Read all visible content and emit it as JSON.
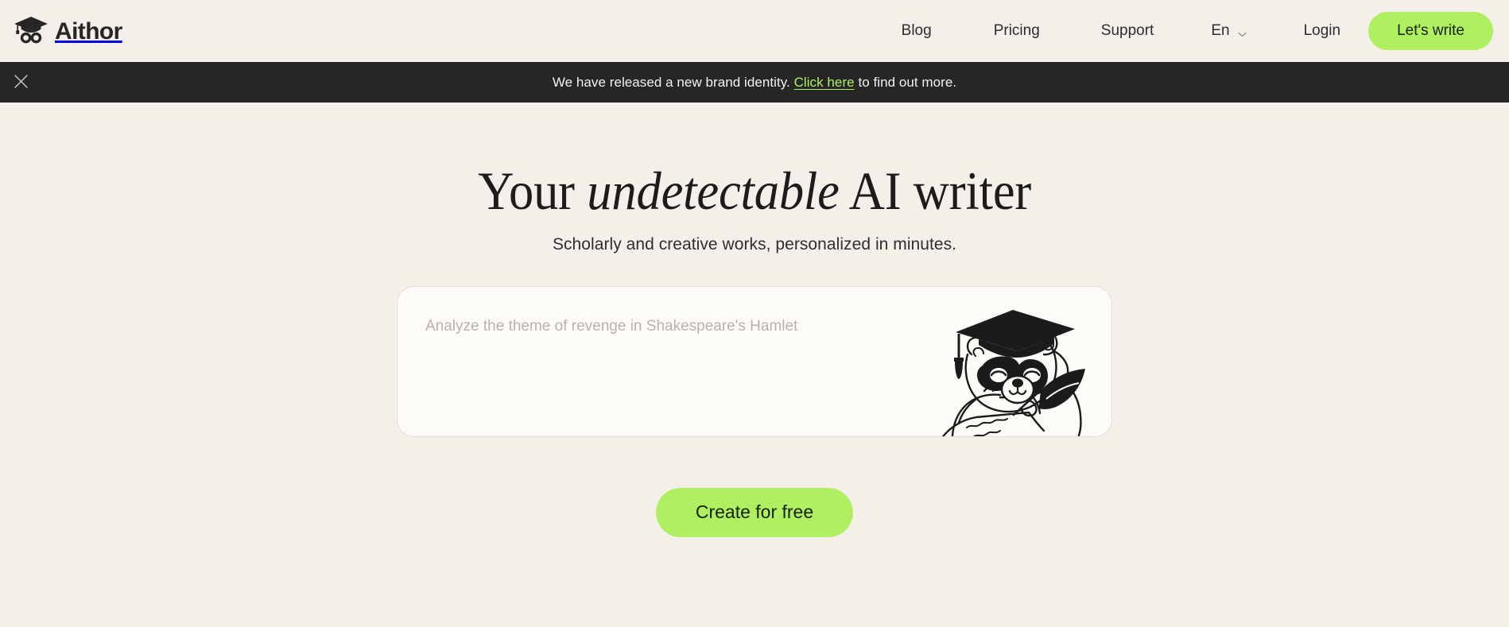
{
  "brand": {
    "name": "Aithor",
    "logo_icon": "graduation-cap-infinity-icon"
  },
  "nav": {
    "items": [
      {
        "label": "Blog",
        "name": "blog"
      },
      {
        "label": "Pricing",
        "name": "pricing"
      },
      {
        "label": "Support",
        "name": "support"
      }
    ],
    "language": {
      "label": "En",
      "caret_icon": "chevron-down-icon"
    },
    "login_label": "Login",
    "cta_label": "Let's write"
  },
  "banner": {
    "close_icon": "close-icon",
    "text_before": "We have released a new brand identity. ",
    "link_label": "Click here",
    "text_after": " to find out more."
  },
  "hero": {
    "title_part1": "Your ",
    "title_emphasis": "undetectable",
    "title_part2": " AI writer",
    "subtitle": "Scholarly and creative works, personalized in minutes."
  },
  "prompt": {
    "value": "",
    "placeholder": "Analyze the theme of revenge in Shakespeare's Hamlet",
    "mascot_icon": "raccoon-graduate-writing-icon"
  },
  "primary_cta": {
    "label": "Create for free"
  },
  "colors": {
    "page_background": "#f4efe9",
    "banner_background": "#262626",
    "accent_green": "#aef05f",
    "card_background": "#fdfbf8",
    "card_border": "#e6dfd6",
    "text_dark": "#262626",
    "placeholder": "#b8b2ab"
  }
}
